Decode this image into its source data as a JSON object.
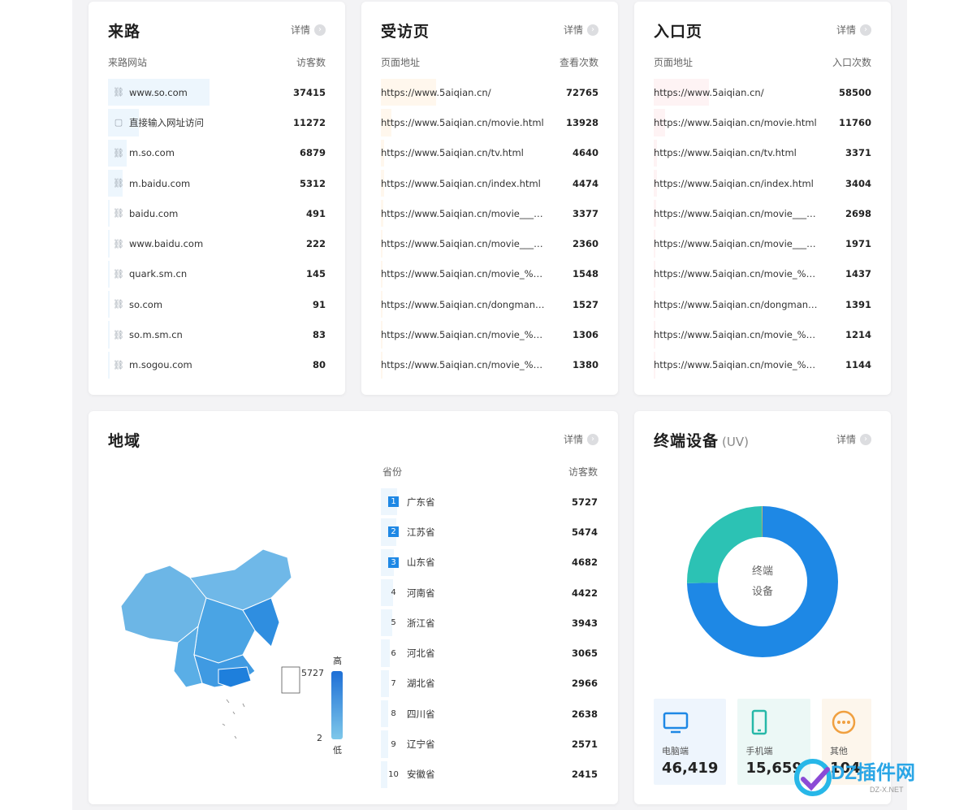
{
  "common": {
    "detail_label": "详情"
  },
  "referrer": {
    "title": "来路",
    "col1": "来路网站",
    "col2": "访客数",
    "rows": [
      {
        "label": "www.so.com",
        "value": "37415",
        "icon": "link-icon"
      },
      {
        "label": "直接输入网址访问",
        "value": "11272",
        "icon": "direct-icon"
      },
      {
        "label": "m.so.com",
        "value": "6879",
        "icon": "link-icon"
      },
      {
        "label": "m.baidu.com",
        "value": "5312",
        "icon": "link-icon"
      },
      {
        "label": "baidu.com",
        "value": "491",
        "icon": "link-icon"
      },
      {
        "label": "www.baidu.com",
        "value": "222",
        "icon": "link-icon"
      },
      {
        "label": "quark.sm.cn",
        "value": "145",
        "icon": "link-icon"
      },
      {
        "label": "so.com",
        "value": "91",
        "icon": "link-icon"
      },
      {
        "label": "so.m.sm.cn",
        "value": "83",
        "icon": "link-icon"
      },
      {
        "label": "m.sogou.com",
        "value": "80",
        "icon": "link-icon"
      }
    ]
  },
  "visited": {
    "title": "受访页",
    "col1": "页面地址",
    "col2": "查看次数",
    "rows": [
      {
        "label": "https://www.5aiqian.cn/",
        "value": "72765"
      },
      {
        "label": "https://www.5aiqian.cn/movie.html",
        "value": "13928"
      },
      {
        "label": "https://www.5aiqian.cn/tv.html",
        "value": "4640"
      },
      {
        "label": "https://www.5aiqian.cn/index.html",
        "value": "4474"
      },
      {
        "label": "https://www.5aiqian.cn/movie____r...",
        "value": "3377"
      },
      {
        "label": "https://www.5aiqian.cn/movie____r...",
        "value": "2360"
      },
      {
        "label": "https://www.5aiqian.cn/movie_%E5...",
        "value": "1548"
      },
      {
        "label": "https://www.5aiqian.cn/dongman_%...",
        "value": "1527"
      },
      {
        "label": "https://www.5aiqian.cn/movie_%E5...",
        "value": "1306"
      },
      {
        "label": "https://www.5aiqian.cn/movie_%E7...",
        "value": "1380"
      }
    ]
  },
  "entry": {
    "title": "入口页",
    "col1": "页面地址",
    "col2": "入口次数",
    "rows": [
      {
        "label": "https://www.5aiqian.cn/",
        "value": "58500"
      },
      {
        "label": "https://www.5aiqian.cn/movie.html",
        "value": "11760"
      },
      {
        "label": "https://www.5aiqian.cn/tv.html",
        "value": "3371"
      },
      {
        "label": "https://www.5aiqian.cn/index.html",
        "value": "3404"
      },
      {
        "label": "https://www.5aiqian.cn/movie____r...",
        "value": "2698"
      },
      {
        "label": "https://www.5aiqian.cn/movie____r...",
        "value": "1971"
      },
      {
        "label": "https://www.5aiqian.cn/movie_%E5...",
        "value": "1437"
      },
      {
        "label": "https://www.5aiqian.cn/dongman_%...",
        "value": "1391"
      },
      {
        "label": "https://www.5aiqian.cn/movie_%E5...",
        "value": "1214"
      },
      {
        "label": "https://www.5aiqian.cn/movie_%E7...",
        "value": "1144"
      }
    ]
  },
  "region": {
    "title": "地域",
    "col1": "省份",
    "col2": "访客数",
    "legend_high": "高",
    "legend_low": "低",
    "legend_max": "5727",
    "legend_min": "2",
    "rows": [
      {
        "rank": "1",
        "label": "广东省",
        "value": "5727"
      },
      {
        "rank": "2",
        "label": "江苏省",
        "value": "5474"
      },
      {
        "rank": "3",
        "label": "山东省",
        "value": "4682"
      },
      {
        "rank": "4",
        "label": "河南省",
        "value": "4422"
      },
      {
        "rank": "5",
        "label": "浙江省",
        "value": "3943"
      },
      {
        "rank": "6",
        "label": "河北省",
        "value": "3065"
      },
      {
        "rank": "7",
        "label": "湖北省",
        "value": "2966"
      },
      {
        "rank": "8",
        "label": "四川省",
        "value": "2638"
      },
      {
        "rank": "9",
        "label": "辽宁省",
        "value": "2571"
      },
      {
        "rank": "10",
        "label": "安徽省",
        "value": "2415"
      }
    ]
  },
  "device": {
    "title": "终端设备",
    "subtitle": "(UV)",
    "center_line1": "终端",
    "center_line2": "设备",
    "tiles": [
      {
        "label": "电脑端",
        "value": "46,419",
        "icon": "desktop-icon",
        "bg": "#eef5fd",
        "color": "#1e88e5"
      },
      {
        "label": "手机端",
        "value": "15,659",
        "icon": "mobile-icon",
        "bg": "#ecf8f6",
        "color": "#26b8a8"
      },
      {
        "label": "其他",
        "value": "104",
        "icon": "more-icon",
        "bg": "#fdf6ec",
        "color": "#f0a040"
      }
    ],
    "colors": {
      "desktop": "#1e88e5",
      "mobile": "#2cc2b4"
    }
  },
  "watermark": {
    "text": "DZ插件网",
    "sub": "DZ-X.NET"
  }
}
